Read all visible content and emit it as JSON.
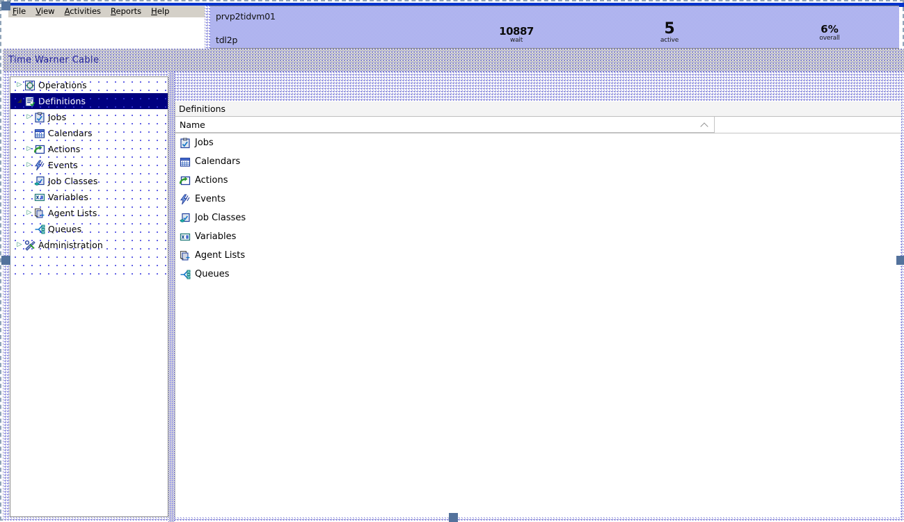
{
  "window": {
    "title_bar_color": "#0033cc"
  },
  "menubar": {
    "items": [
      {
        "label": "File",
        "accel": "F"
      },
      {
        "label": "View",
        "accel": "V"
      },
      {
        "label": "Activities",
        "accel": "A"
      },
      {
        "label": "Reports",
        "accel": "R"
      },
      {
        "label": "Help",
        "accel": "H"
      }
    ]
  },
  "statusbar": {
    "hostname": "prvp2tidvm01",
    "instance": "tdl2p",
    "metrics": [
      {
        "id": "wait",
        "value": "10887",
        "label": "wait"
      },
      {
        "id": "active",
        "value": "5",
        "label": "active"
      },
      {
        "id": "overall",
        "value": "6%",
        "label": "overall"
      }
    ]
  },
  "brand": {
    "name": "Time Warner Cable",
    "color": "#23239a"
  },
  "tree": {
    "items": [
      {
        "label": "Operations",
        "icon": "operations-icon",
        "indent": 0,
        "twisty": "collapsed",
        "selected": false
      },
      {
        "label": "Definitions",
        "icon": "definitions-icon",
        "indent": 0,
        "twisty": "expanded",
        "selected": true
      },
      {
        "label": "Jobs",
        "icon": "jobs-icon",
        "indent": 1,
        "twisty": "collapsed",
        "selected": false
      },
      {
        "label": "Calendars",
        "icon": "calendars-icon",
        "indent": 1,
        "twisty": "empty",
        "selected": false
      },
      {
        "label": "Actions",
        "icon": "actions-icon",
        "indent": 1,
        "twisty": "collapsed",
        "selected": false
      },
      {
        "label": "Events",
        "icon": "events-icon",
        "indent": 1,
        "twisty": "collapsed",
        "selected": false
      },
      {
        "label": "Job Classes",
        "icon": "job-classes-icon",
        "indent": 1,
        "twisty": "empty",
        "selected": false
      },
      {
        "label": "Variables",
        "icon": "variables-icon",
        "indent": 1,
        "twisty": "empty",
        "selected": false
      },
      {
        "label": "Agent Lists",
        "icon": "agent-lists-icon",
        "indent": 1,
        "twisty": "collapsed",
        "selected": false
      },
      {
        "label": "Queues",
        "icon": "queues-icon",
        "indent": 1,
        "twisty": "empty",
        "selected": false
      },
      {
        "label": "Administration",
        "icon": "administration-icon",
        "indent": 0,
        "twisty": "collapsed",
        "selected": false
      }
    ],
    "selected_color": "#000080"
  },
  "list": {
    "title": "Definitions",
    "columns": [
      {
        "label": "Name",
        "sort": "ascending",
        "sort_icon": "chevron-up-icon"
      }
    ],
    "rows": [
      {
        "name": "Jobs",
        "icon": "jobs-icon"
      },
      {
        "name": "Calendars",
        "icon": "calendars-icon"
      },
      {
        "name": "Actions",
        "icon": "actions-icon"
      },
      {
        "name": "Events",
        "icon": "events-icon"
      },
      {
        "name": "Job Classes",
        "icon": "job-classes-icon"
      },
      {
        "name": "Variables",
        "icon": "variables-icon"
      },
      {
        "name": "Agent Lists",
        "icon": "agent-lists-icon"
      },
      {
        "name": "Queues",
        "icon": "queues-icon"
      }
    ]
  },
  "selection": {
    "handle_color": "#53729c",
    "border_color": "#8fa3b8"
  }
}
